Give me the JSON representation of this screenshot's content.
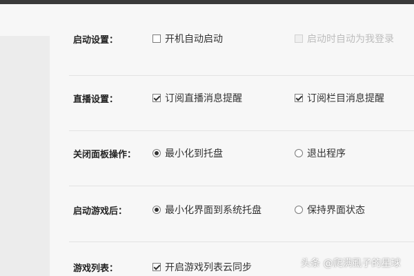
{
  "settings": {
    "startup": {
      "label": "启动设置：",
      "options": [
        {
          "text": "开机自动启动",
          "checked": false,
          "disabled": false
        },
        {
          "text": "启动时自动为我登录",
          "checked": false,
          "disabled": true
        }
      ]
    },
    "live": {
      "label": "直播设置：",
      "options": [
        {
          "text": "订阅直播消息提醒",
          "checked": true
        },
        {
          "text": "订阅栏目消息提醒",
          "checked": true
        }
      ]
    },
    "close_panel": {
      "label": "关闭面板操作：",
      "options": [
        {
          "text": "最小化到托盘",
          "selected": true
        },
        {
          "text": "退出程序",
          "selected": false
        }
      ]
    },
    "after_game": {
      "label": "启动游戏后：",
      "options": [
        {
          "text": "最小化界面到系统托盘",
          "selected": true
        },
        {
          "text": "保持界面状态",
          "selected": false
        }
      ]
    },
    "game_list": {
      "label": "游戏列表：",
      "options": [
        {
          "text": "开启游戏列表云同步",
          "checked": true
        }
      ]
    }
  },
  "watermark": "头条 @爬满虱子的星球"
}
